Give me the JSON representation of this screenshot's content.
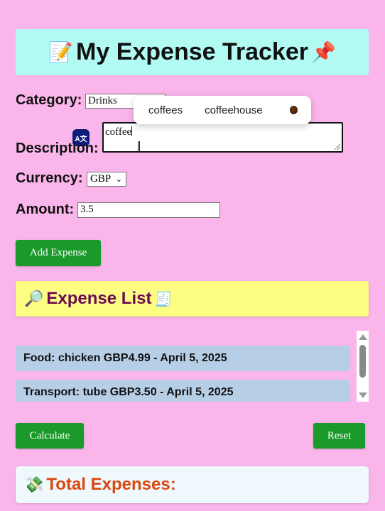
{
  "header": {
    "title": "My Expense Tracker",
    "left_emoji": "📝",
    "right_emoji": "📌"
  },
  "form": {
    "category_label": "Category:",
    "category_value": "Drinks",
    "description_label": "Description:",
    "description_value": "coffee",
    "currency_label": "Currency:",
    "currency_value": "GBP",
    "amount_label": "Amount:",
    "amount_value": "3.5",
    "add_button": "Add Expense"
  },
  "autocomplete": {
    "suggestions": [
      "coffees",
      "coffeehouse"
    ],
    "emoji_name": "coffee-bean-icon"
  },
  "list": {
    "title": "Expense List",
    "left_emoji": "🔎",
    "right_emoji": "🧾",
    "items": [
      "Food: chicken GBP4.99 - April 5, 2025",
      "Transport: tube GBP3.50 - April 5, 2025"
    ]
  },
  "actions": {
    "calculate": "Calculate",
    "reset": "Reset"
  },
  "total": {
    "title": "Total Expenses:",
    "emoji": "💸"
  },
  "colors": {
    "page_bg": "#fab5ea",
    "title_bg": "#b2fbf2",
    "list_head_bg": "#fdfc83",
    "row_bg": "#b7cfe6",
    "button_green": "#1a9a2a",
    "total_text": "#d9480f"
  }
}
